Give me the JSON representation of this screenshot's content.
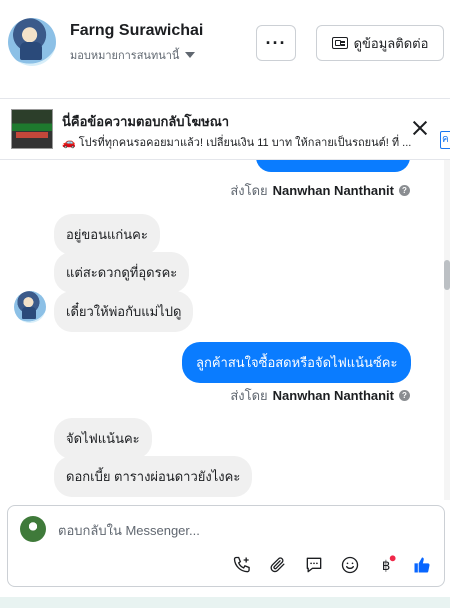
{
  "header": {
    "name": "Farng Surawichai",
    "assign_label": "มอบหมายการสนทนานี้",
    "more_label": "···",
    "contact_label": "ดูข้อมูลติดต่อ"
  },
  "ad_reply": {
    "title": "นี่คือข้อความตอบกลับโฆษณา",
    "subtitle": "🚗 โปรที่ทุกคนรอคอยมาแล้ว! เปลี่ยนเงิน 11 บาท ให้กลายเป็นรถยนต์! ที่ ...",
    "edge_label": "ค"
  },
  "messages": {
    "sent_by_prefix": "ส่งโดย",
    "sender_name": "Nanwhan Nanthanit",
    "incoming_1": "อยู่ขอนแก่นคะ",
    "incoming_2": "แต่สะดวกดูที่อุดรคะ",
    "incoming_3": "เดี๋ยวให้พ่อกับแม่ไปดู",
    "outgoing_1": "ลูกค้าสนใจซื้อสดหรือจัดไฟแน้นซ์คะ",
    "incoming_4": "จัดไฟแน้นคะ",
    "incoming_5": "ดอกเบี้ย ตารางผ่อนดาวยังไงคะ"
  },
  "composer": {
    "placeholder": "ตอบกลับใน Messenger..."
  },
  "icons": {
    "call": "phone-plus-icon",
    "attach": "paperclip-icon",
    "saved_reply": "chat-bubble-icon",
    "emoji": "smiley-icon",
    "payment": "baht-icon",
    "like": "thumbs-up-icon"
  },
  "colors": {
    "accent": "#0a7cff",
    "notification_dot": "#f02849",
    "like_blue": "#0866ff"
  }
}
